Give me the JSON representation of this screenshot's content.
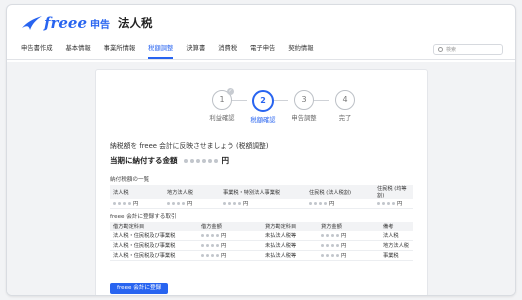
{
  "header": {
    "brand": "freee",
    "brand_sub": "申告",
    "app_title": "法人税"
  },
  "nav": {
    "items": [
      "申告書作成",
      "基本情報",
      "事業所情報",
      "税額調整",
      "決算書",
      "消費税",
      "電子申告",
      "契約情報"
    ],
    "active_index": 3,
    "search_placeholder": "検索"
  },
  "steps": [
    {
      "number": "1",
      "label": "利益確認",
      "state": "done"
    },
    {
      "number": "2",
      "label": "税額確認",
      "state": "active"
    },
    {
      "number": "3",
      "label": "申告調整",
      "state": "todo"
    },
    {
      "number": "4",
      "label": "完了",
      "state": "todo"
    }
  ],
  "main": {
    "lead_text": "納税額を freee 会計に反映させましょう (税額調整)",
    "total_label": "当期に納付する金額",
    "total_unit": "円"
  },
  "tax_list": {
    "title": "納付税額の一覧",
    "headers": [
      "法人税",
      "地方法人税",
      "事業税・特別法人事業税",
      "住民税 (法人税割)",
      "住民税 (均等割)"
    ],
    "unit": "円"
  },
  "journal": {
    "title": "freee 会計に登録する取引",
    "headers": [
      "借方勘定科目",
      "借方金額",
      "貸方勘定科目",
      "貸方金額",
      "備考"
    ],
    "rows": [
      {
        "debit": "法人税・住民税及び事業税",
        "credit": "未払法人税等",
        "memo": "法人税"
      },
      {
        "debit": "法人税・住民税及び事業税",
        "credit": "未払法人税等",
        "memo": "地方法人税"
      },
      {
        "debit": "法人税・住民税及び事業税",
        "credit": "未払法人税等",
        "memo": "事業税"
      }
    ],
    "unit": "円"
  },
  "register_button": "freee 会計に登録",
  "colors": {
    "accent": "#2864f0",
    "muted": "#c2c6cc"
  }
}
